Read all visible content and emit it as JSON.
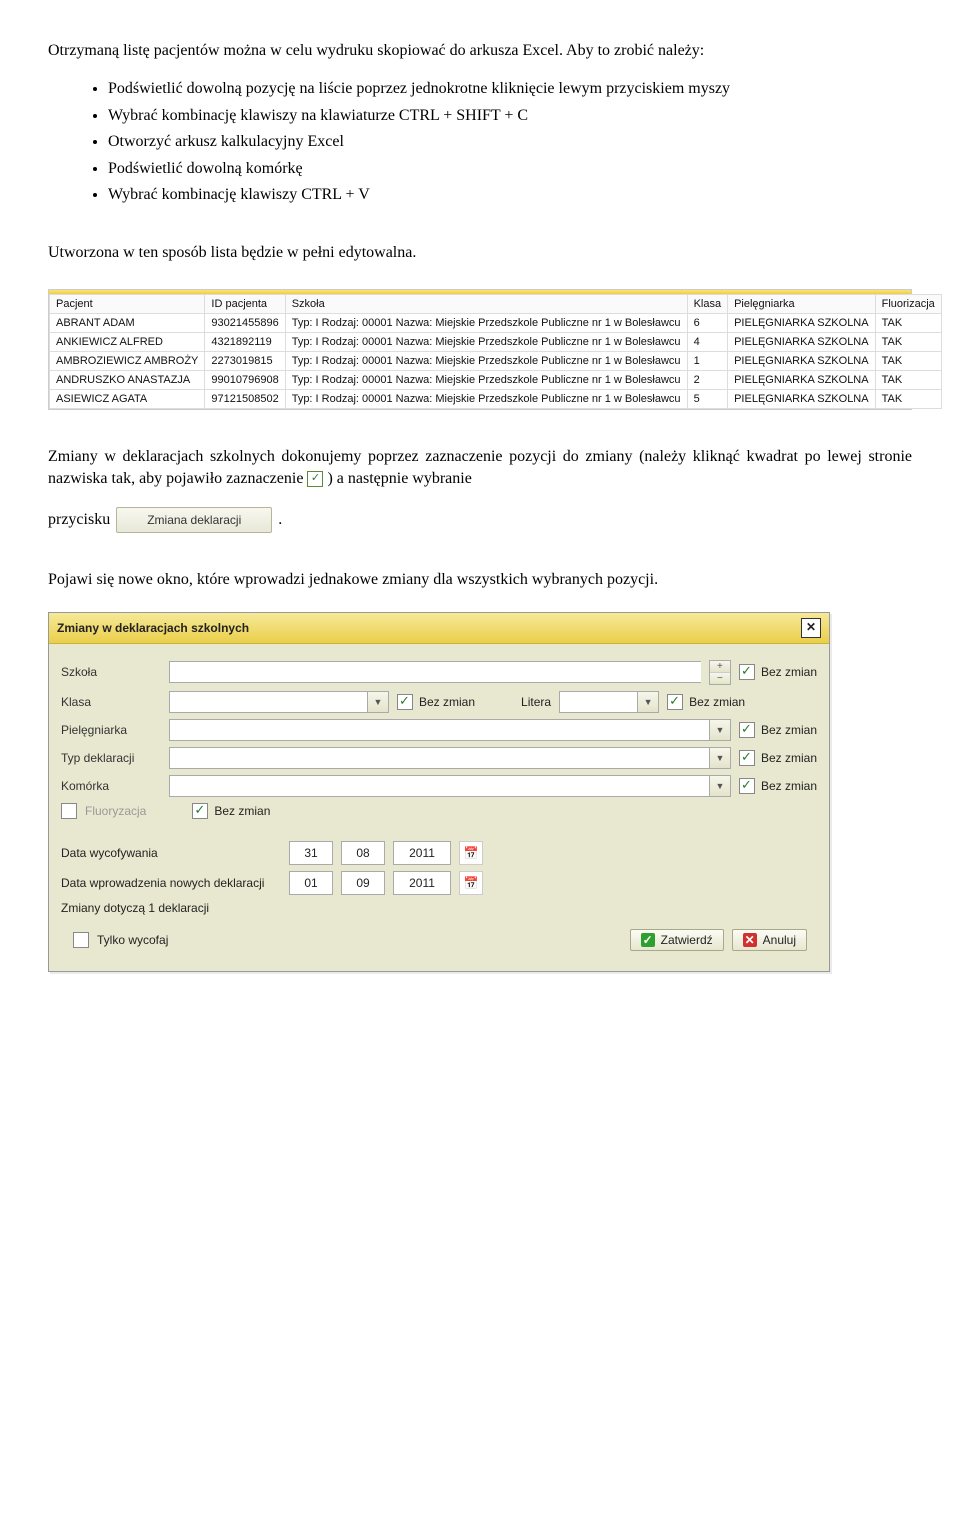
{
  "p1": "Otrzymaną listę pacjentów można w celu wydruku skopiować do arkusza Excel. Aby to zrobić należy:",
  "bullets": [
    "Podświetlić dowolną pozycję na liście poprzez jednokrotne kliknięcie lewym przyciskiem myszy",
    "Wybrać kombinację klawiszy na klawiaturze CTRL + SHIFT + C",
    "Otworzyć arkusz kalkulacyjny Excel",
    "Podświetlić dowolną komórkę",
    "Wybrać kombinację klawiszy CTRL + V"
  ],
  "p2": "Utworzona w ten sposób lista będzie w pełni edytowalna.",
  "table": {
    "headers": [
      "Pacjent",
      "ID pacjenta",
      "Szkoła",
      "Klasa",
      "Pielęgniarka",
      "Fluorizacja"
    ],
    "rows": [
      {
        "pacjent": "ABRANT ADAM",
        "id": "93021455896",
        "szkola": "Typ: I Rodzaj: 00001 Nazwa: Miejskie Przedszkole Publiczne nr 1 w Bolesławcu",
        "klasa": "6",
        "pieleg": "PIELĘGNIARKA SZKOLNA",
        "fluor": "TAK"
      },
      {
        "pacjent": "ANKIEWICZ ALFRED",
        "id": "4321892119",
        "szkola": "Typ: I Rodzaj: 00001 Nazwa: Miejskie Przedszkole Publiczne nr 1 w Bolesławcu",
        "klasa": "4",
        "pieleg": "PIELĘGNIARKA SZKOLNA",
        "fluor": "TAK"
      },
      {
        "pacjent": "AMBROZIEWICZ AMBROŻY",
        "id": "2273019815",
        "szkola": "Typ: I Rodzaj: 00001 Nazwa: Miejskie Przedszkole Publiczne nr 1 w Bolesławcu",
        "klasa": "1",
        "pieleg": "PIELĘGNIARKA SZKOLNA",
        "fluor": "TAK"
      },
      {
        "pacjent": "ANDRUSZKO ANASTAZJA",
        "id": "99010796908",
        "szkola": "Typ: I Rodzaj: 00001 Nazwa: Miejskie Przedszkole Publiczne nr 1 w Bolesławcu",
        "klasa": "2",
        "pieleg": "PIELĘGNIARKA SZKOLNA",
        "fluor": "TAK"
      },
      {
        "pacjent": "ASIEWICZ AGATA",
        "id": "97121508502",
        "szkola": "Typ: I Rodzaj: 00001 Nazwa: Miejskie Przedszkole Publiczne nr 1 w Bolesławcu",
        "klasa": "5",
        "pieleg": "PIELĘGNIARKA SZKOLNA",
        "fluor": "TAK"
      }
    ]
  },
  "p3a": "Zmiany w deklaracjach szkolnych dokonujemy poprzez zaznaczenie pozycji do zmiany (należy kliknąć kwadrat po lewej stronie nazwiska tak, aby pojawiło zaznaczenie ",
  "p3b": ") a następnie wybranie",
  "p3c": "przycisku ",
  "p3d": ".",
  "zmianaBtn": "Zmiana deklaracji",
  "p4": "Pojawi się nowe okno, które wprowadzi jednakowe zmiany dla wszystkich wybranych pozycji.",
  "dialog": {
    "title": "Zmiany w deklaracjach szkolnych",
    "labels": {
      "szkola": "Szkoła",
      "klasa": "Klasa",
      "litera": "Litera",
      "pieleg": "Pielęgniarka",
      "typ": "Typ deklaracji",
      "komorka": "Komórka",
      "fluor": "Fluoryzacja",
      "bezzmian": "Bez zmian",
      "dataWycof": "Data wycofywania",
      "dataWprow": "Data wprowadzenia nowych deklaracji",
      "zmianyDot": "Zmiany dotyczą 1 deklaracji",
      "tylkoWycofaj": "Tylko wycofaj",
      "zatwierdz": "Zatwierdź",
      "anuluj": "Anuluj"
    },
    "dataWycof": {
      "d": "31",
      "m": "08",
      "y": "2011"
    },
    "dataWprow": {
      "d": "01",
      "m": "09",
      "y": "2011"
    }
  }
}
